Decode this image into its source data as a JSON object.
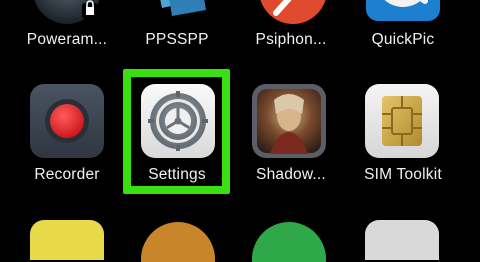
{
  "row1": [
    {
      "label": "Poweram..."
    },
    {
      "label": "PPSSPP"
    },
    {
      "label": "Psiphon..."
    },
    {
      "label": "QuickPic"
    }
  ],
  "row2": [
    {
      "label": "Recorder"
    },
    {
      "label": "Settings"
    },
    {
      "label": "Shadow..."
    },
    {
      "label": "SIM Toolkit"
    }
  ],
  "highlight_color": "#39e011",
  "icons": {
    "poweramp": "poweramp-icon",
    "ppsspp": "ppsspp-icon",
    "psiphon": "psiphon-icon",
    "quickpic": "quickpic-icon",
    "recorder": "recorder-icon",
    "settings": "settings-gear-icon",
    "shadow": "shadow-game-icon",
    "sim": "sim-card-icon"
  }
}
